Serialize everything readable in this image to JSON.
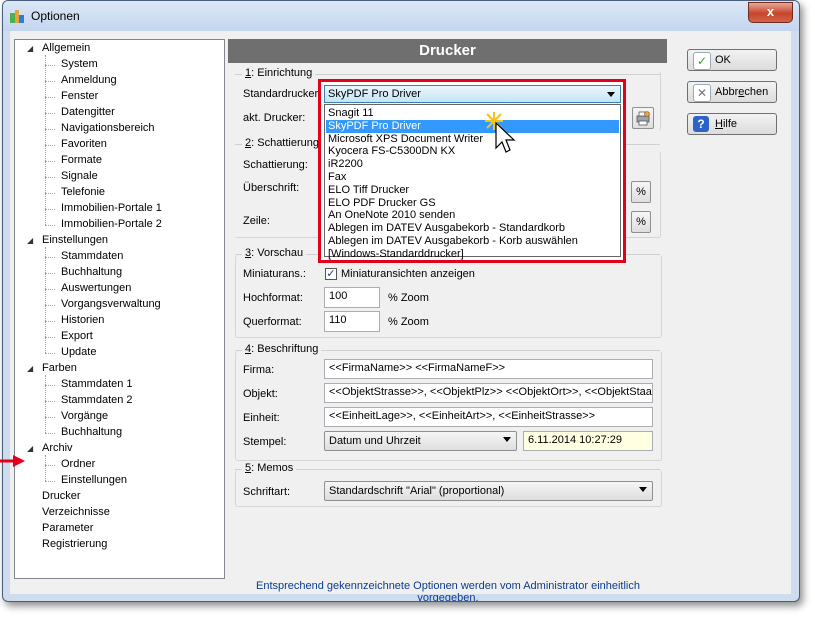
{
  "window": {
    "title": "Optionen",
    "close_glyph": "x"
  },
  "tree": {
    "items": [
      {
        "label": "Allgemein",
        "level": 0,
        "expanded": true
      },
      {
        "label": "System",
        "level": 1
      },
      {
        "label": "Anmeldung",
        "level": 1
      },
      {
        "label": "Fenster",
        "level": 1
      },
      {
        "label": "Datengitter",
        "level": 1
      },
      {
        "label": "Navigationsbereich",
        "level": 1
      },
      {
        "label": "Favoriten",
        "level": 1
      },
      {
        "label": "Formate",
        "level": 1
      },
      {
        "label": "Signale",
        "level": 1
      },
      {
        "label": "Telefonie",
        "level": 1
      },
      {
        "label": "Immobilien-Portale 1",
        "level": 1
      },
      {
        "label": "Immobilien-Portale 2",
        "level": 1
      },
      {
        "label": "Einstellungen",
        "level": 0,
        "expanded": true
      },
      {
        "label": "Stammdaten",
        "level": 1
      },
      {
        "label": "Buchhaltung",
        "level": 1
      },
      {
        "label": "Auswertungen",
        "level": 1
      },
      {
        "label": "Vorgangsverwaltung",
        "level": 1
      },
      {
        "label": "Historien",
        "level": 1
      },
      {
        "label": "Export",
        "level": 1
      },
      {
        "label": "Update",
        "level": 1
      },
      {
        "label": "Farben",
        "level": 0,
        "expanded": true
      },
      {
        "label": "Stammdaten 1",
        "level": 1
      },
      {
        "label": "Stammdaten 2",
        "level": 1
      },
      {
        "label": "Vorgänge",
        "level": 1
      },
      {
        "label": "Buchhaltung",
        "level": 1
      },
      {
        "label": "Archiv",
        "level": 0,
        "expanded": true
      },
      {
        "label": "Ordner",
        "level": 1
      },
      {
        "label": "Einstellungen",
        "level": 1
      },
      {
        "label": "Drucker",
        "level": 0,
        "selected": true
      },
      {
        "label": "Verzeichnisse",
        "level": 0
      },
      {
        "label": "Parameter",
        "level": 0
      },
      {
        "label": "Registrierung",
        "level": 0
      }
    ]
  },
  "panel": {
    "header": "Drucker"
  },
  "einrichtung": {
    "num": "1",
    "title": ": Einrichtung",
    "standarddrucker_label": "Standardrucker:",
    "standarddrucker_value": "SkyPDF Pro Driver",
    "akt_drucker_label": "akt. Drucker:"
  },
  "schattierung": {
    "num": "2",
    "title": ": Schattierung",
    "schattierung_label": "Schattierung:",
    "ueberschrift_label": "Überschrift:",
    "zeile_label": "Zeile:",
    "pct1": "%",
    "pct2": "%"
  },
  "printer_dropdown": {
    "selected": "SkyPDF Pro Driver",
    "options": [
      "Snagit 11",
      "SkyPDF Pro Driver",
      "Microsoft XPS Document Writer",
      "Kyocera FS-C5300DN KX",
      "iR2200",
      "Fax",
      "ELO Tiff Drucker",
      "ELO PDF Drucker GS",
      "An OneNote 2010 senden",
      "Ablegen im DATEV Ausgabekorb - Standardkorb",
      "Ablegen im DATEV Ausgabekorb - Korb auswählen",
      "[Windows-Standarddrucker]"
    ],
    "highlighted_index": 1
  },
  "vorschau": {
    "num": "3",
    "title": ": Vorschau",
    "miniaturans_label": "Miniaturans.:",
    "miniaturans_checked": true,
    "miniaturans_text": "Miniaturansichten anzeigen",
    "hochformat_label": "Hochformat:",
    "hochformat_value": "100",
    "hochformat_unit": "% Zoom",
    "querformat_label": "Querformat:",
    "querformat_value": "110",
    "querformat_unit": "% Zoom"
  },
  "beschriftung": {
    "num": "4",
    "title": ": Beschriftung",
    "firma_label": "Firma:",
    "firma_value": "<<FirmaName>> <<FirmaNameF>>",
    "objekt_label": "Objekt:",
    "objekt_value": "<<ObjektStrasse>>, <<ObjektPlz>> <<ObjektOrt>>, <<ObjektStaat>>",
    "einheit_label": "Einheit:",
    "einheit_value": "<<EinheitLage>>, <<EinheitArt>>, <<EinheitStrasse>>",
    "stempel_label": "Stempel:",
    "stempel_value": "Datum und Uhrzeit",
    "stempel_preview": "6.11.2014 10:27:29"
  },
  "memos": {
    "num": "5",
    "title": ": Memos",
    "schriftart_label": "Schriftart:",
    "schriftart_value": "Standardschrift \"Arial\" (proportional)"
  },
  "buttons": {
    "ok": "OK",
    "abbrechen_pre": "Abbr",
    "abbrechen_u": "e",
    "abbrechen_post": "chen",
    "hilfe_u": "H",
    "hilfe_post": "ilfe"
  },
  "footer": "Entsprechend gekennzeichnete Optionen werden vom Administrator einheitlich vorgegeben.",
  "colors": {
    "highlight": "#3399ff",
    "red_frame": "#e3001b",
    "footer_text": "#0b3c8f"
  },
  "icons": [
    "app-icon",
    "close-icon",
    "ok-check-icon",
    "cancel-x-icon",
    "help-question-icon",
    "printer-settings-icon",
    "red-arrow-icon",
    "mouse-cursor-icon"
  ]
}
